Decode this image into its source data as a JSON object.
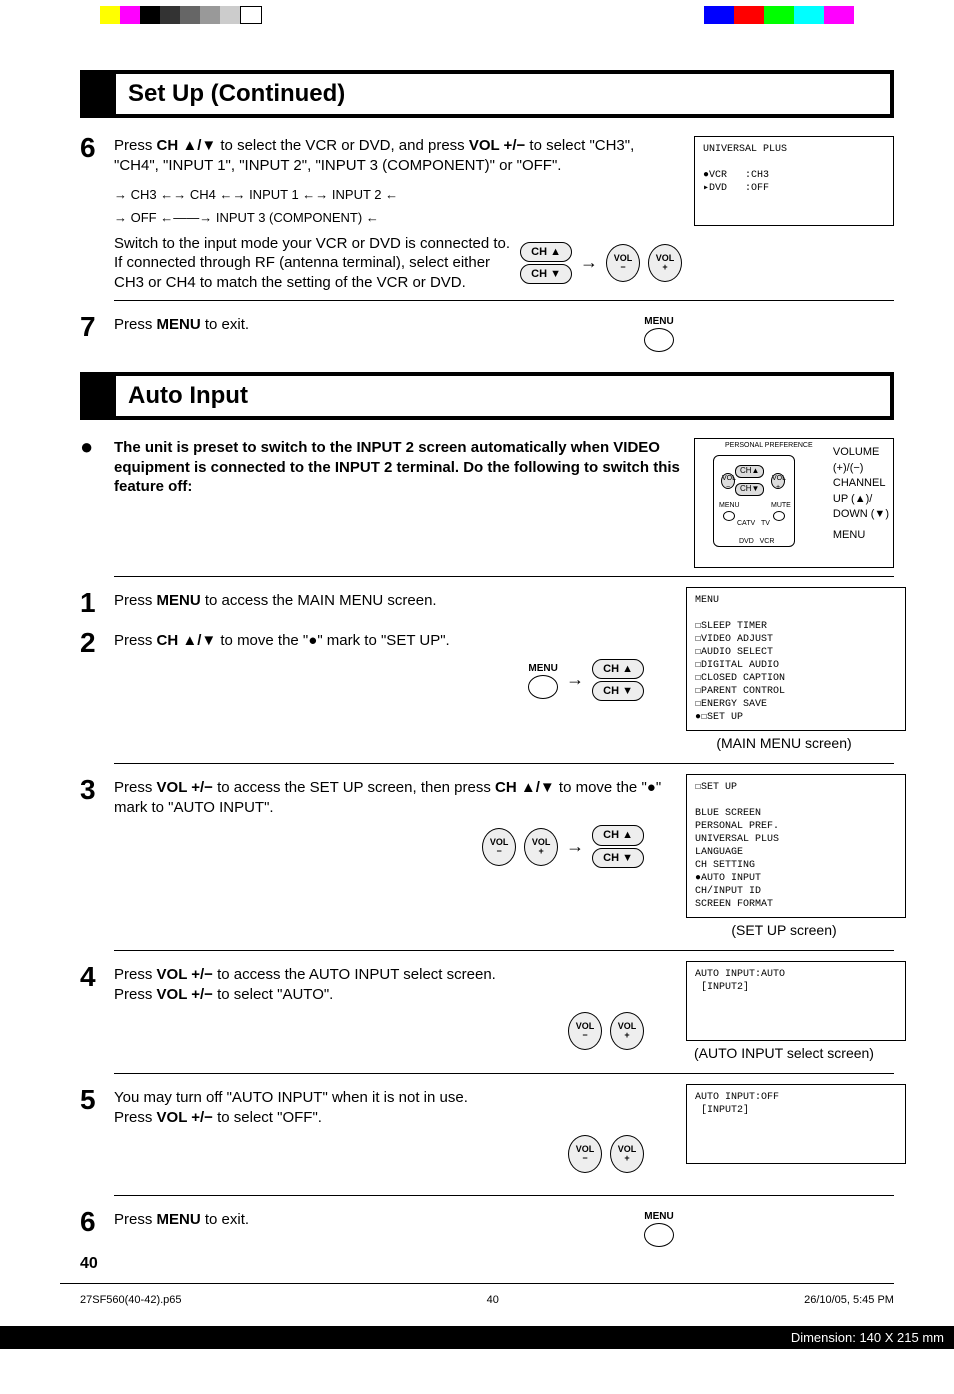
{
  "titles": {
    "setup": "Set Up (Continued)",
    "autoInput": "Auto Input"
  },
  "step6": {
    "num": "6",
    "text1a": "Press ",
    "text1b": "CH ▲/▼",
    "text1c": " to select the VCR or DVD, and press ",
    "text1d": "VOL +/−",
    "text1e": " to select \"CH3\", \"CH4\", \"INPUT 1\", \"INPUT 2\", \"INPUT 3 (COMPONENT)\" or \"OFF\".",
    "chainLine1": "→ CH3 ←→ CH4 ←→ INPUT 1 ←→ INPUT 2 ←",
    "chainLine2": "→ OFF ←——→ INPUT 3 (COMPONENT) ←",
    "text2": "Switch to the input mode your VCR or DVD is connected to. If connected through RF (antenna terminal), select either CH3 or CH4 to match the setting of the VCR or DVD.",
    "screen": "UNIVERSAL PLUS\n\n●VCR   :CH3\n▸DVD   :OFF"
  },
  "step7": {
    "num": "7",
    "text": "Press ",
    "bold": "MENU",
    "text2": " to exit."
  },
  "bulletNote": {
    "line1": "The unit is preset to switch to the INPUT 2 screen automatically when VIDEO equipment is connected to the INPUT 2 terminal. Do the following to switch this feature off:",
    "remoteLabels": {
      "volume": "VOLUME",
      "volSigns": "(+)/(−)",
      "channel": "CHANNEL",
      "up": "UP (▲)/",
      "down": "DOWN (▼)",
      "menu": "MENU"
    }
  },
  "step1": {
    "num": "1",
    "text": "Press ",
    "bold": "MENU",
    "text2": " to access the MAIN MENU screen."
  },
  "step2": {
    "num": "2",
    "text": "Press ",
    "bold": "CH ▲/▼",
    "text2": " to move the \"●\" mark to \"SET UP\".",
    "screen": "MENU\n\n☐SLEEP TIMER\n☐VIDEO ADJUST\n☐AUDIO SELECT\n☐DIGITAL AUDIO\n☐CLOSED CAPTION\n☐PARENT CONTROL\n☐ENERGY SAVE\n●☐SET UP",
    "caption": "(MAIN MENU screen)"
  },
  "step3": {
    "num": "3",
    "text": "Press ",
    "bold": "VOL +/−",
    "text2": " to access the SET UP screen, then press ",
    "bold2": "CH ▲/▼",
    "text3": " to move the \"●\" mark to \"AUTO INPUT\".",
    "screen": "☐SET UP\n\nBLUE SCREEN\nPERSONAL PREF.\nUNIVERSAL PLUS\nLANGUAGE\nCH SETTING\n●AUTO INPUT\nCH/INPUT ID\nSCREEN FORMAT",
    "caption": "(SET UP screen)"
  },
  "step4": {
    "num": "4",
    "text": "Press ",
    "bold": "VOL +/−",
    "text2": " to access the AUTO INPUT select screen.",
    "line2a": "Press ",
    "line2b": "VOL +/−",
    "line2c": " to select \"AUTO\".",
    "screen": "AUTO INPUT:AUTO\n [INPUT2]",
    "caption": "(AUTO INPUT select screen)"
  },
  "step5": {
    "num": "5",
    "text": "You may turn off \"AUTO INPUT\" when it is not in use.",
    "line2a": "Press ",
    "line2b": "VOL +/−",
    "line2c": " to select \"OFF\".",
    "screen": "AUTO INPUT:OFF\n [INPUT2]"
  },
  "step6b": {
    "num": "6",
    "text": "Press ",
    "bold": "MENU",
    "text2": " to exit."
  },
  "pageNum": "40",
  "footer": {
    "file": "27SF560(40-42).p65",
    "filePage": "40",
    "date": "26/10/05, 5:45 PM",
    "dim": "Dimension: 140  X 215 mm"
  },
  "keys": {
    "chUp": "CH ▲",
    "chDown": "CH ▼",
    "volMinus": "VOL\n−",
    "volPlus": "VOL\n+",
    "menu": "MENU"
  }
}
